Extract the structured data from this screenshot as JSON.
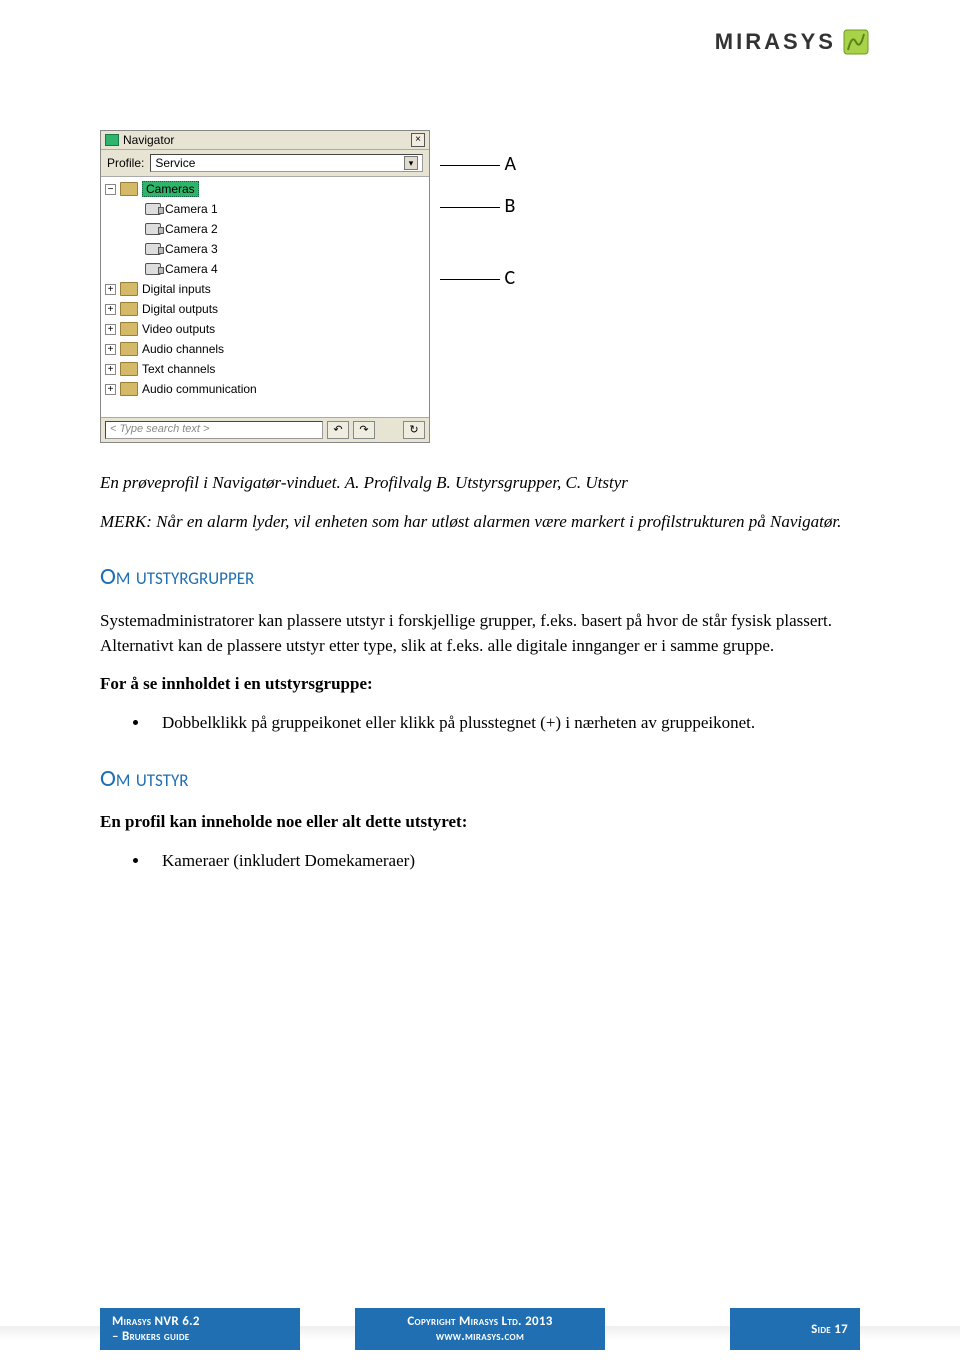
{
  "brand": {
    "name": "MIRASYS"
  },
  "navigator": {
    "title": "Navigator",
    "profile_label": "Profile:",
    "profile_value": "Service",
    "search_placeholder": "< Type search text >",
    "tree": {
      "selected": "Cameras",
      "cameras": [
        "Camera 1",
        "Camera 2",
        "Camera 3",
        "Camera 4"
      ],
      "groups": [
        "Digital inputs",
        "Digital outputs",
        "Video outputs",
        "Audio channels",
        "Text channels",
        "Audio communication"
      ]
    }
  },
  "callouts": {
    "a": "A",
    "b": "B",
    "c": "C"
  },
  "caption": "En prøveprofil i Navigatør-vinduet. A. Profilvalg B. Utstyrsgrupper, C. Utstyr",
  "note": "MERK: Når en alarm lyder, vil enheten som har utløst alarmen være markert i profilstrukturen på Navigatør.",
  "sec1": {
    "title": "Om utstyrgrupper",
    "p1": "Systemadministratorer kan plassere utstyr i forskjellige grupper, f.eks. basert på hvor de står fysisk plassert. Alternativt kan de plassere utstyr etter type, slik at f.eks. alle digitale innganger er i samme gruppe.",
    "bold": "For å se innholdet i en utstyrsgruppe:",
    "bullet": "Dobbelklikk på gruppeikonet eller klikk på plusstegnet (+) i nærheten av gruppeikonet."
  },
  "sec2": {
    "title": "Om utstyr",
    "bold": "En profil kan inneholde noe eller alt dette utstyret:",
    "bullet": "Kameraer (inkludert Domekameraer)"
  },
  "footer": {
    "product": "Mirasys NVR 6.2",
    "sub": "– Brukers guide",
    "copyright": "Copyright Mirasys Ltd. 2013",
    "url": "www.mirasys.com",
    "page": "Side 17"
  }
}
